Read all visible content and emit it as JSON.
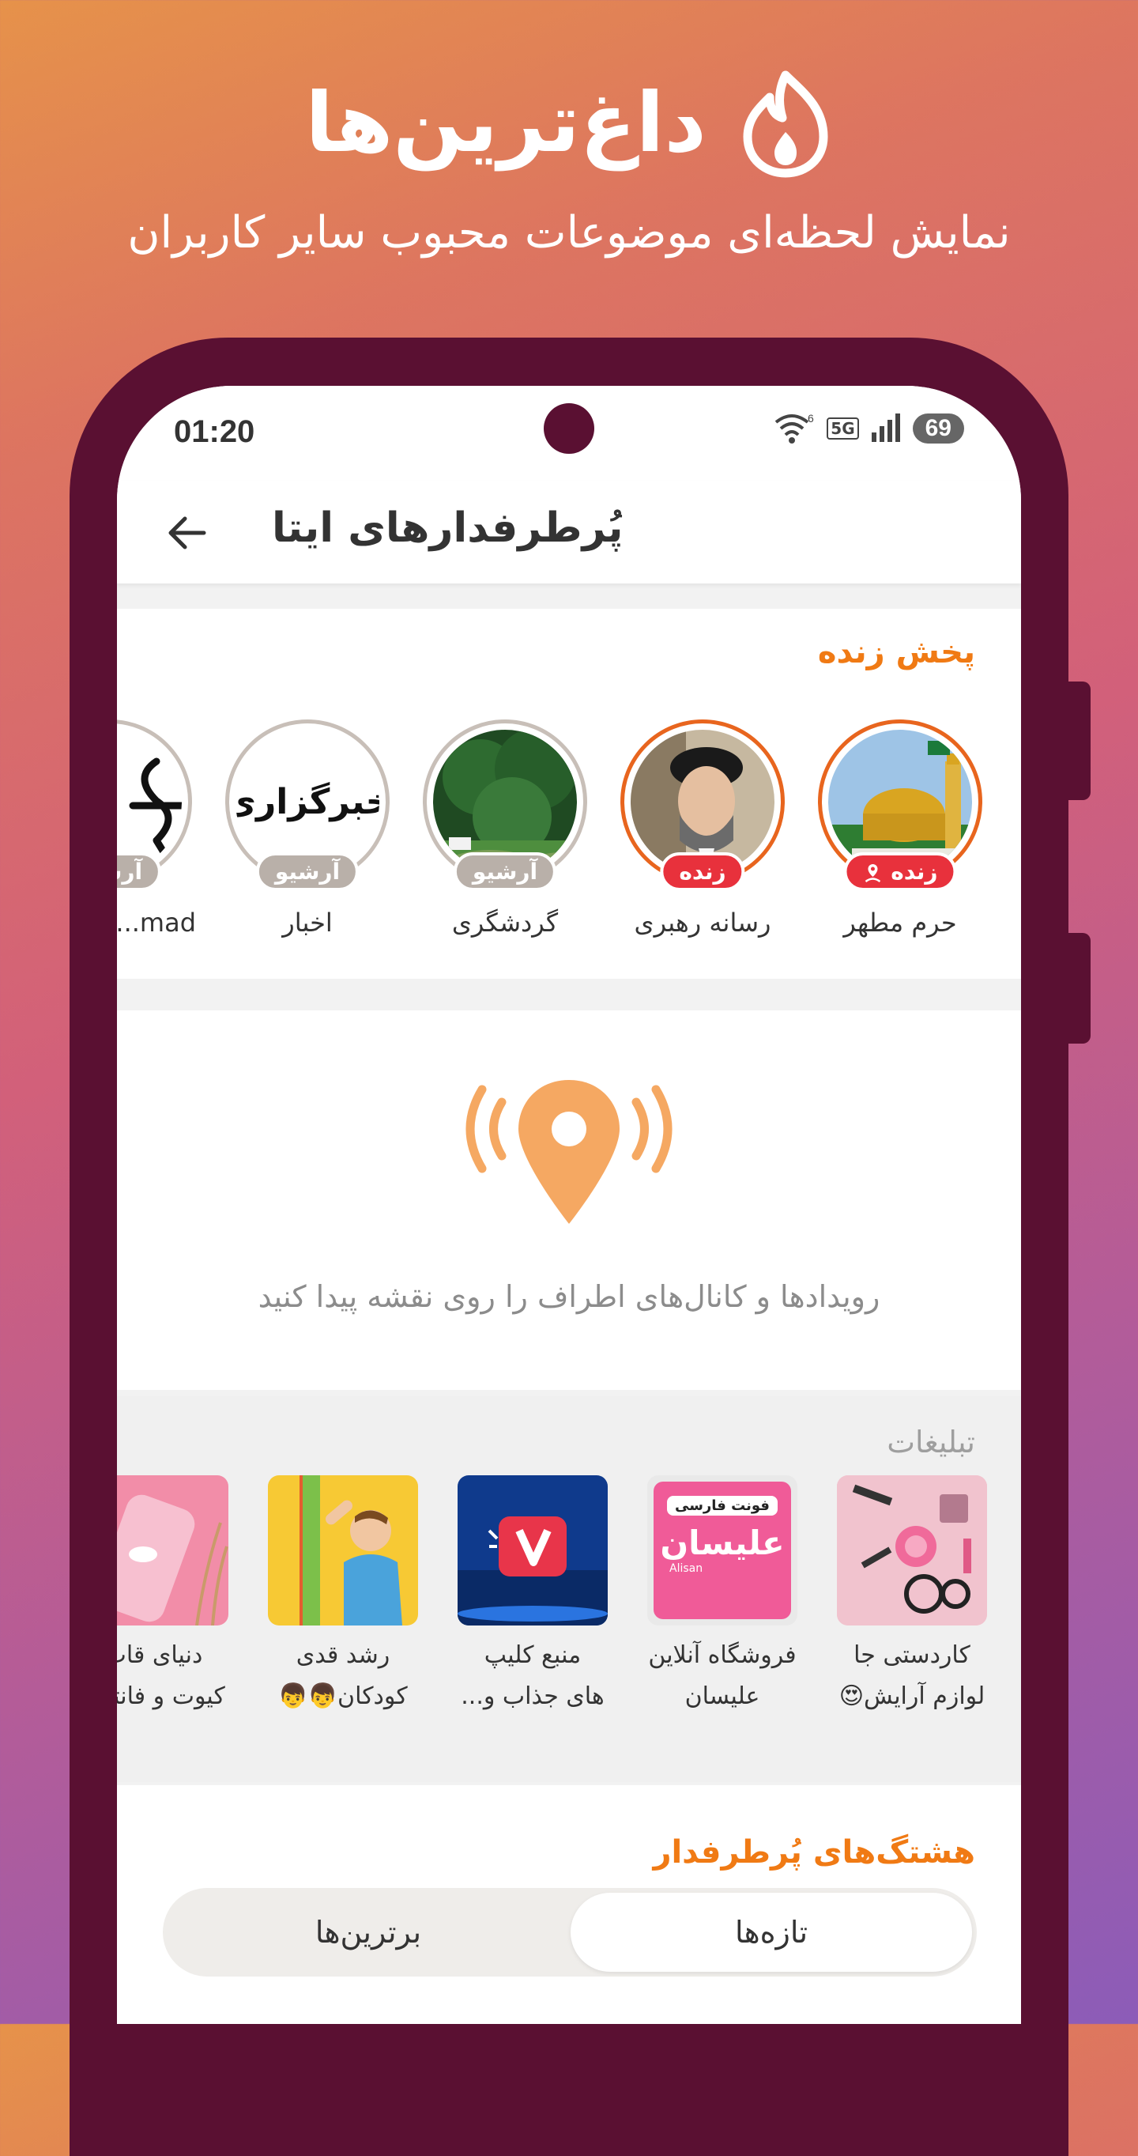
{
  "hero": {
    "title": "داغ‌ترین‌ها",
    "subtitle": "نمایش لحظه‌ای موضوعات محبوب سایر کاربران"
  },
  "status_bar": {
    "time": "01:20",
    "battery": "69",
    "network": "5G",
    "wifi_label": "6"
  },
  "app_bar": {
    "title": "پُرطرفدارهای ایتا",
    "back_icon": "arrow-left-icon"
  },
  "live_section": {
    "title": "پخش زنده",
    "stories": [
      {
        "name": "حرم مطهر",
        "badge": "زنده",
        "status": "live"
      },
      {
        "name": "رسانه رهبری",
        "badge": "زنده",
        "status": "live"
      },
      {
        "name": "گردشگری",
        "badge": "آرشیو",
        "status": "archive"
      },
      {
        "name": "اخبار",
        "badge": "آرشیو",
        "status": "archive",
        "logo_text": "خبرگزاری"
      },
      {
        "name": "mad...",
        "badge": "آرشیو",
        "status": "archive"
      }
    ]
  },
  "map_section": {
    "text": "رویدادها و کانال‌های اطراف را روی نقشه پیدا کنید",
    "icon": "location-broadcast-icon",
    "accent": "#F5A862"
  },
  "ads_section": {
    "title": "تبلیغات",
    "items": [
      {
        "line1": "کاردستی جا",
        "line2": "لوازم آرایش😍"
      },
      {
        "line1": "فروشگاه آنلاین",
        "line2": "علیسان",
        "img_text": "علیسان",
        "img_tag": "فونت فارسی",
        "img_sub": "Alisan"
      },
      {
        "line1": "منبع کلیپ",
        "line2": "های جذاب و..."
      },
      {
        "line1": "رشد قدی",
        "line2": "کودکان👦👦"
      },
      {
        "line1": "دنیای قاب",
        "line2": "کیوت و فانتزی"
      }
    ]
  },
  "hashtags_section": {
    "title": "هشتگ‌های پُرطرفدار",
    "tabs": [
      {
        "label": "تازه‌ها",
        "active": true
      },
      {
        "label": "برترین‌ها",
        "active": false
      }
    ]
  },
  "colors": {
    "accent": "#F07A14",
    "live_badge": "#E8313C",
    "archive_badge": "#B9B0A9",
    "phone_frame": "#5A1032"
  }
}
